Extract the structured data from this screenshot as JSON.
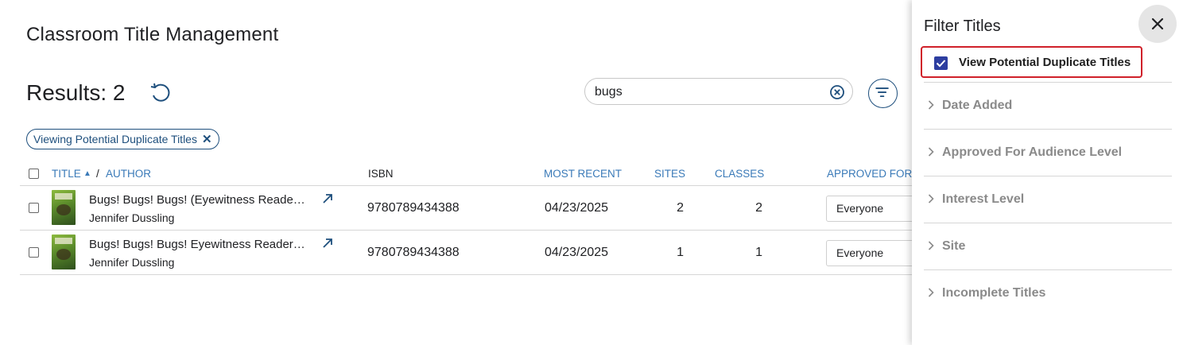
{
  "header": {
    "title": "Classroom Title Management"
  },
  "results": {
    "label": "Results: 2"
  },
  "search": {
    "value": "bugs",
    "placeholder": ""
  },
  "active_filter_chip": {
    "label": "Viewing Potential Duplicate Titles"
  },
  "table": {
    "columns": {
      "title": "TITLE",
      "sort_indicator": "▲",
      "separator": "/",
      "author": "AUTHOR",
      "isbn": "ISBN",
      "most_recent": "MOST RECENT",
      "sites": "SITES",
      "classes": "CLASSES",
      "approved_for": "APPROVED FOR"
    },
    "rows": [
      {
        "title": "Bugs! Bugs! Bugs! (Eyewitness Reade…",
        "author": "Jennifer Dussling",
        "isbn": "9780789434388",
        "most_recent": "04/23/2025",
        "sites": "2",
        "classes": "2",
        "approved_for": "Everyone"
      },
      {
        "title": "Bugs! Bugs! Bugs! Eyewitness Reader…",
        "author": "Jennifer Dussling",
        "isbn": "9780789434388",
        "most_recent": "04/23/2025",
        "sites": "1",
        "classes": "1",
        "approved_for": "Everyone"
      }
    ]
  },
  "filter_panel": {
    "title": "Filter Titles",
    "duplicate_toggle": {
      "label": "View Potential Duplicate Titles",
      "checked": true
    },
    "sections": [
      {
        "label": "Date Added"
      },
      {
        "label": "Approved For Audience Level"
      },
      {
        "label": "Interest Level"
      },
      {
        "label": "Site"
      },
      {
        "label": "Incomplete Titles"
      }
    ]
  },
  "colors": {
    "accent": "#1e4f7d",
    "link": "#3a7ab8",
    "checkbox": "#2d3ea0",
    "highlight": "#d0212a"
  },
  "icons": [
    "refresh-icon",
    "clear-search-icon",
    "filter-icon",
    "close-chip-icon",
    "open-link-icon",
    "close-icon",
    "chevron-right-icon",
    "book-cover-image"
  ]
}
